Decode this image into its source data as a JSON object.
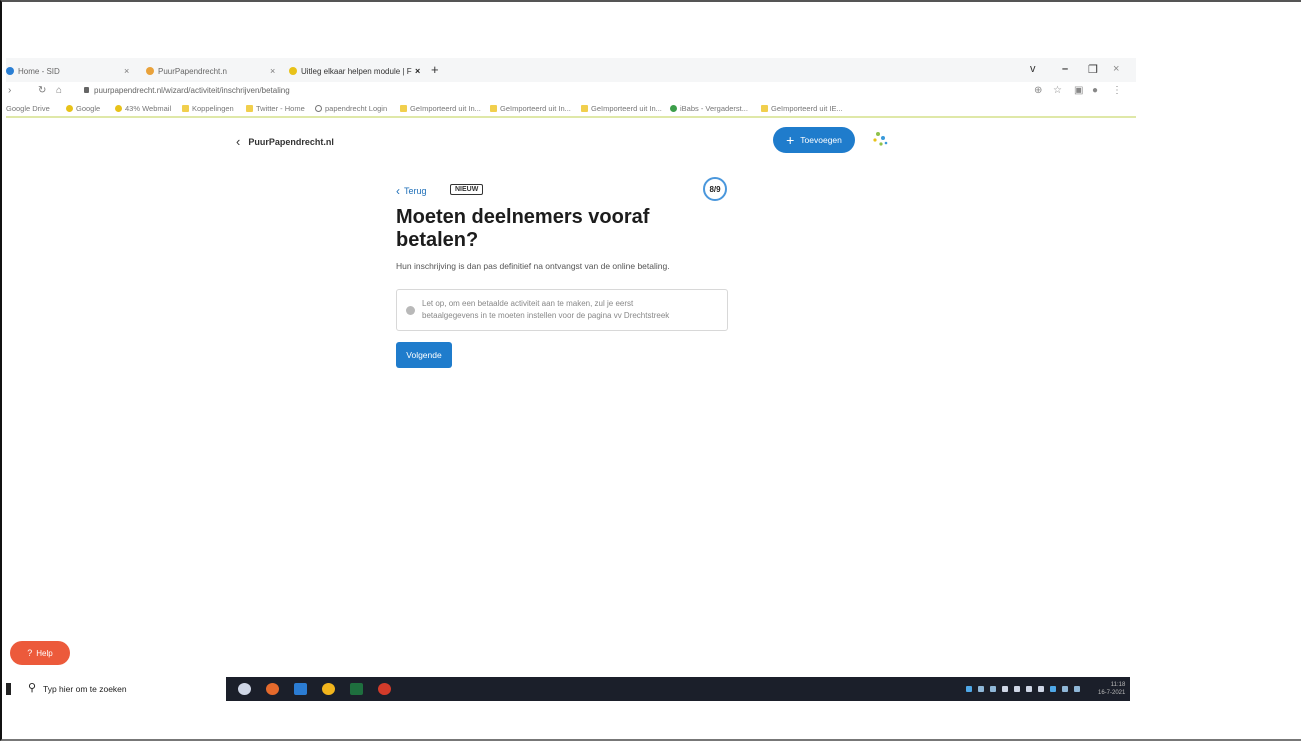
{
  "browser": {
    "tabs": [
      {
        "label": "Home - SID",
        "fav_color": "#2a7fd4"
      },
      {
        "label": "PuurPapendrecht.n",
        "fav_color": "#e9a23b"
      },
      {
        "label": "Uitleg elkaar helpen module | F",
        "fav_color": "#e8c219"
      }
    ],
    "new_tab": "+",
    "close_glyph": "×",
    "window_controls": [
      "v",
      "–",
      "❐",
      "×"
    ],
    "url": "puurpapendrecht.nl/wizard/activiteit/inschrijven/betaling",
    "bookmarks": [
      {
        "label": "Google Drive",
        "color": "#3c9e4a"
      },
      {
        "label": "Google",
        "color": "#e8c219"
      },
      {
        "label": "43% Webmail",
        "color": "#e8c219"
      },
      {
        "label": "Koppelingen",
        "color": "#f1cf4d"
      },
      {
        "label": "Twitter - Home",
        "color": "#f1cf4d"
      },
      {
        "label": "papendrecht Login",
        "color": "#777777"
      },
      {
        "label": "Geïmporteerd uit In...",
        "color": "#f1cf4d"
      },
      {
        "label": "Geïmporteerd uit In...",
        "color": "#f1cf4d"
      },
      {
        "label": "Geïmporteerd uit In...",
        "color": "#f1cf4d"
      },
      {
        "label": "iBabs - Vergaderst...",
        "color": "#3c9e4a"
      },
      {
        "label": "Geïmporteerd uit IE...",
        "color": "#f1cf4d"
      }
    ]
  },
  "header": {
    "site_link": "PuurPapendrecht.nl",
    "add_button": "Toevoegen"
  },
  "wizard": {
    "back_label": "Terug",
    "badge": "NIEUW",
    "step": "8/9",
    "title": "Moeten deelnemers vooraf betalen?",
    "description": "Hun inschrijving is dan pas definitief na ontvangst van de online betaling.",
    "notice_line1": "Let op, om een betaalde activiteit aan te maken, zul je eerst",
    "notice_line2": "betaalgegevens in te moeten instellen voor de pagina vv Drechtstreek",
    "next_button": "Volgende"
  },
  "help": {
    "label": "Help"
  },
  "taskbar": {
    "search_placeholder": "Typ hier om te zoeken",
    "clock_time": "11:18",
    "clock_date": "16-7-2021"
  },
  "colors": {
    "primary": "#1f7ccc",
    "help": "#ec5a3b",
    "taskbar": "#1b1f2a"
  }
}
